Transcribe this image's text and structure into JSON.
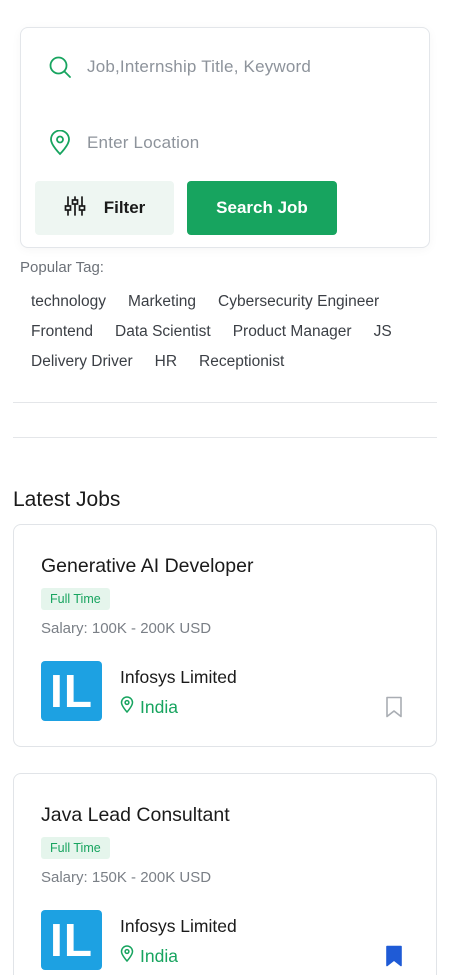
{
  "search": {
    "keyword_placeholder": "Job,Internship Title, Keyword",
    "location_placeholder": "Enter Location",
    "filter_label": "Filter",
    "search_label": "Search Job"
  },
  "popular": {
    "label": "Popular Tag:",
    "rows": [
      [
        "technology",
        "Marketing",
        "Cybersecurity Engineer"
      ],
      [
        "Frontend",
        "Data Scientist",
        "Product Manager",
        "JS"
      ],
      [
        "Delivery Driver",
        "HR",
        "Receptionist"
      ]
    ]
  },
  "latest": {
    "title": "Latest Jobs",
    "jobs": [
      {
        "title": "Generative AI Developer",
        "type": "Full Time",
        "salary": "Salary: 100K - 200K USD",
        "company": "Infosys Limited",
        "logo_text": "IL",
        "location": "India",
        "saved": false
      },
      {
        "title": "Java Lead Consultant",
        "type": "Full Time",
        "salary": "Salary: 150K - 200K USD",
        "company": "Infosys Limited",
        "logo_text": "IL",
        "location": "India",
        "saved": true
      }
    ]
  },
  "colors": {
    "accent_green": "#17a45f",
    "logo_blue": "#1da1e2",
    "bookmark_blue": "#1f5bd6"
  },
  "icons": {
    "keyword": "search-icon",
    "location": "location-pin-icon",
    "filter": "sliders-icon",
    "bookmark": "bookmark-icon"
  }
}
